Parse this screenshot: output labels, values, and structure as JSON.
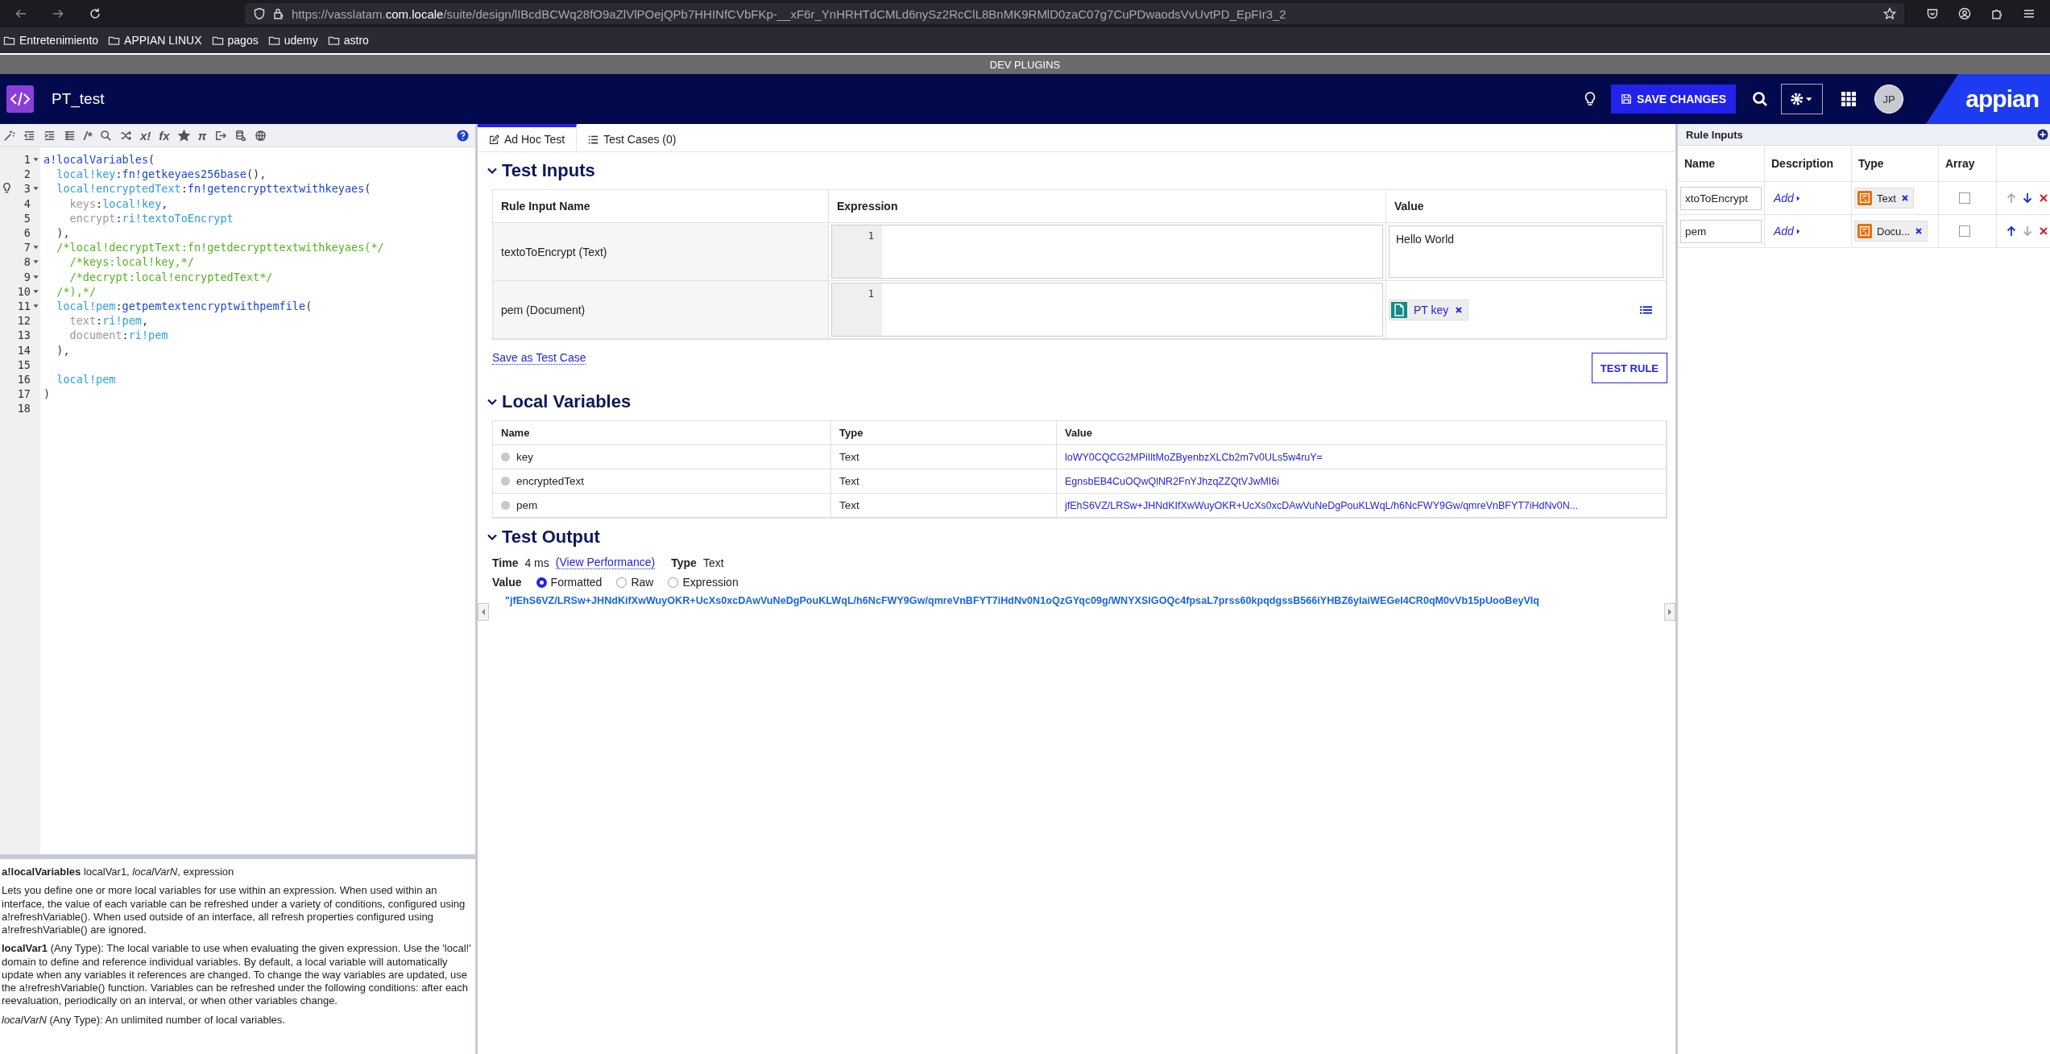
{
  "browser": {
    "url": {
      "before": "https://vasslatam.",
      "domain": "com.locale",
      "after": "/suite/design/lIBcdBCWq28fO9aZlVlPOejQPb7HHINfCVbFKp-__xF6r_YnHRHTdCMLd6nySz2RcClL8BnMK9RMlD0zaC07g7CuPDwaodsVvUvtPD_EpFIr3_2"
    },
    "bookmarks": [
      "Entretenimiento",
      "APPIAN LINUX",
      "pagos",
      "udemy",
      "astro"
    ]
  },
  "env_bar": "DEV PLUGINS",
  "header": {
    "title": "PT_test",
    "save_button": "SAVE CHANGES",
    "avatar": "JP",
    "logo": "appian"
  },
  "editor": {
    "toolbar": [
      {
        "kind": "icon"
      },
      {
        "kind": "icon"
      },
      {
        "kind": "icon"
      },
      {
        "kind": "icon"
      },
      {
        "kind": "symbol",
        "text": "/*"
      },
      {
        "kind": "icon"
      },
      {
        "kind": "icon"
      },
      {
        "kind": "symbol",
        "text": "x!"
      },
      {
        "kind": "symbol",
        "text": "fx"
      },
      {
        "kind": "icon"
      },
      {
        "kind": "symbol",
        "text": "π"
      },
      {
        "kind": "icon"
      },
      {
        "kind": "icon"
      },
      {
        "kind": "icon"
      }
    ],
    "lines": [
      {
        "number": "1",
        "foldable": true,
        "hint": false,
        "tokens": [
          {
            "kind": "fn",
            "text": "a!localVariables"
          },
          {
            "kind": "plain",
            "text": "("
          }
        ]
      },
      {
        "number": "2",
        "foldable": false,
        "hint": false,
        "tokens": [
          {
            "kind": "local",
            "text": "  local!key"
          },
          {
            "kind": "plain",
            "text": ":"
          },
          {
            "kind": "fn",
            "text": "fn!getkeyaes256base"
          },
          {
            "kind": "plain",
            "text": "(),"
          }
        ]
      },
      {
        "number": "3",
        "foldable": true,
        "hint": true,
        "tokens": [
          {
            "kind": "local",
            "text": "  local!encryptedText"
          },
          {
            "kind": "plain",
            "text": ":"
          },
          {
            "kind": "fn",
            "text": "fn!getencrypttextwithkeyaes"
          },
          {
            "kind": "plain",
            "text": "("
          }
        ]
      },
      {
        "number": "4",
        "foldable": false,
        "hint": false,
        "tokens": [
          {
            "kind": "param",
            "text": "    keys"
          },
          {
            "kind": "plain",
            "text": ":"
          },
          {
            "kind": "local",
            "text": "local!key"
          },
          {
            "kind": "plain",
            "text": ","
          }
        ]
      },
      {
        "number": "5",
        "foldable": false,
        "hint": false,
        "tokens": [
          {
            "kind": "param",
            "text": "    encrypt"
          },
          {
            "kind": "plain",
            "text": ":"
          },
          {
            "kind": "local",
            "text": "ri!textoToEncrypt"
          }
        ]
      },
      {
        "number": "6",
        "foldable": false,
        "hint": false,
        "tokens": [
          {
            "kind": "plain",
            "text": "  ),"
          }
        ]
      },
      {
        "number": "7",
        "foldable": true,
        "hint": false,
        "tokens": [
          {
            "kind": "comment",
            "text": "  /*local!decryptText:fn!getdecrypttextwithkeyaes(*/"
          }
        ]
      },
      {
        "number": "8",
        "foldable": true,
        "hint": false,
        "tokens": [
          {
            "kind": "comment",
            "text": "    /*keys:local!key,*/"
          }
        ]
      },
      {
        "number": "9",
        "foldable": true,
        "hint": false,
        "tokens": [
          {
            "kind": "comment",
            "text": "    /*decrypt:local!encryptedText*/"
          }
        ]
      },
      {
        "number": "10",
        "foldable": true,
        "hint": false,
        "tokens": [
          {
            "kind": "comment",
            "text": "  /*),*/"
          }
        ]
      },
      {
        "number": "11",
        "foldable": true,
        "hint": false,
        "tokens": [
          {
            "kind": "local",
            "text": "  local!pem"
          },
          {
            "kind": "plain",
            "text": ":"
          },
          {
            "kind": "fn",
            "text": "getpemtextencryptwithpemfile"
          },
          {
            "kind": "plain",
            "text": "("
          }
        ]
      },
      {
        "number": "12",
        "foldable": false,
        "hint": false,
        "tokens": [
          {
            "kind": "param",
            "text": "    text"
          },
          {
            "kind": "plain",
            "text": ":"
          },
          {
            "kind": "local",
            "text": "ri!pem"
          },
          {
            "kind": "plain",
            "text": ","
          }
        ]
      },
      {
        "number": "13",
        "foldable": false,
        "hint": false,
        "tokens": [
          {
            "kind": "param",
            "text": "    document"
          },
          {
            "kind": "plain",
            "text": ":"
          },
          {
            "kind": "local",
            "text": "ri!pem"
          }
        ]
      },
      {
        "number": "14",
        "foldable": false,
        "hint": false,
        "tokens": [
          {
            "kind": "plain",
            "text": "  ),"
          }
        ]
      },
      {
        "number": "15",
        "foldable": false,
        "hint": false
      },
      {
        "number": "16",
        "foldable": false,
        "hint": false,
        "tokens": [
          {
            "kind": "local",
            "text": "  local!pem"
          }
        ]
      },
      {
        "number": "17",
        "foldable": false,
        "hint": false,
        "tokens": [
          {
            "kind": "plain",
            "text": ")"
          }
        ]
      },
      {
        "number": "18",
        "foldable": false,
        "hint": false
      }
    ]
  },
  "docs": {
    "signature": "**a!localVariables**  localVar1, *localVarN*, expression",
    "paragraphs": [
      "Lets you define one or more local variables for use within an expression. When used within an interface, the value of each variable can be refreshed under a variety of conditions, configured using a!refreshVariable(). When used outside of an interface, all refresh properties configured using a!refreshVariable() are ignored.",
      "**localVar1** (Any Type): The local variable to use when evaluating the given expression. Use the 'local!' domain to define and reference individual variables. By default, a local variable will automatically update when any variables it references are changed. To change the way variables are updated, use the a!refreshVariable() function. Variables can be refreshed under the following conditions: after each reevaluation, periodically on an interval, or when other variables change.",
      "*localVarN* (Any Type): An unlimited number of local variables."
    ]
  },
  "tabs": [
    {
      "label": "Ad Hoc Test",
      "selected": true
    },
    {
      "label": "Test Cases (0)",
      "selected": false
    }
  ],
  "test_inputs": {
    "title": "Test Inputs",
    "expanded": true,
    "columns": [
      "Rule Input Name",
      "Expression",
      "Value"
    ],
    "rows": [
      {
        "name": "textoToEncrypt (Text)",
        "expression_line": "1",
        "value": {
          "kind": "text",
          "text": "Hello World"
        }
      },
      {
        "name": "pem (Document)",
        "expression_line": "1",
        "value": {
          "kind": "document",
          "text": "PT key"
        }
      }
    ],
    "save_link": "Save as Test Case",
    "test_button": "TEST RULE"
  },
  "local_variables": {
    "title": "Local Variables",
    "expanded": true,
    "columns": [
      "Name",
      "Type",
      "Value"
    ],
    "rows": [
      {
        "name": "key",
        "type": "Text",
        "value": "loWY0CQCG2MPiIltMoZByenbzXLCb2m7v0ULs5w4ruY="
      },
      {
        "name": "encryptedText",
        "type": "Text",
        "value": "EgnsbEB4CuOQwQlNR2FnYJhzqZZQtVJwMI6i"
      },
      {
        "name": "pem",
        "type": "Text",
        "value": "jfEhS6VZ/LRSw+JHNdKIfXwWuyOKR+UcXs0xcDAwVuNeDgPouKLWqL/h6NcFWY9Gw/qmreVnBFYT7iHdNv0N..."
      }
    ]
  },
  "test_output": {
    "title": "Test Output",
    "expanded": true,
    "time_label": "Time",
    "time": "4 ms",
    "performance_link": "(View Performance)",
    "type_label": "Type",
    "type": "Text",
    "value_label": "Value",
    "formats": [
      {
        "label": "Formatted",
        "selected": true
      },
      {
        "label": "Raw",
        "selected": false
      },
      {
        "label": "Expression",
        "selected": false
      }
    ],
    "result": "\"jfEhS6VZ/LRSw+JHNdKifXwWuyOKR+UcXs0xcDAwVuNeDgPouKLWqL/h6NcFWY9Gw/qmreVnBFYT7iHdNv0N1oQzGYqc09g/WNYXSlGOQc4fpsaL7prss60kpqdgssB566iYHBZ6yIaiWEGeI4CR0qM0vVb15pUooBeyVIq"
  },
  "rule_inputs": {
    "title": "Rule Inputs",
    "columns": [
      "Name",
      "Description",
      "Type",
      "Array"
    ],
    "rows": [
      {
        "name": "xtoToEncrypt",
        "description": "Add",
        "type": "Text",
        "array": false,
        "can_move_up": false,
        "can_move_down": true
      },
      {
        "name": "pem",
        "description": "Add",
        "type": "Docu...",
        "array": false,
        "can_move_up": true,
        "can_move_down": false
      }
    ]
  }
}
